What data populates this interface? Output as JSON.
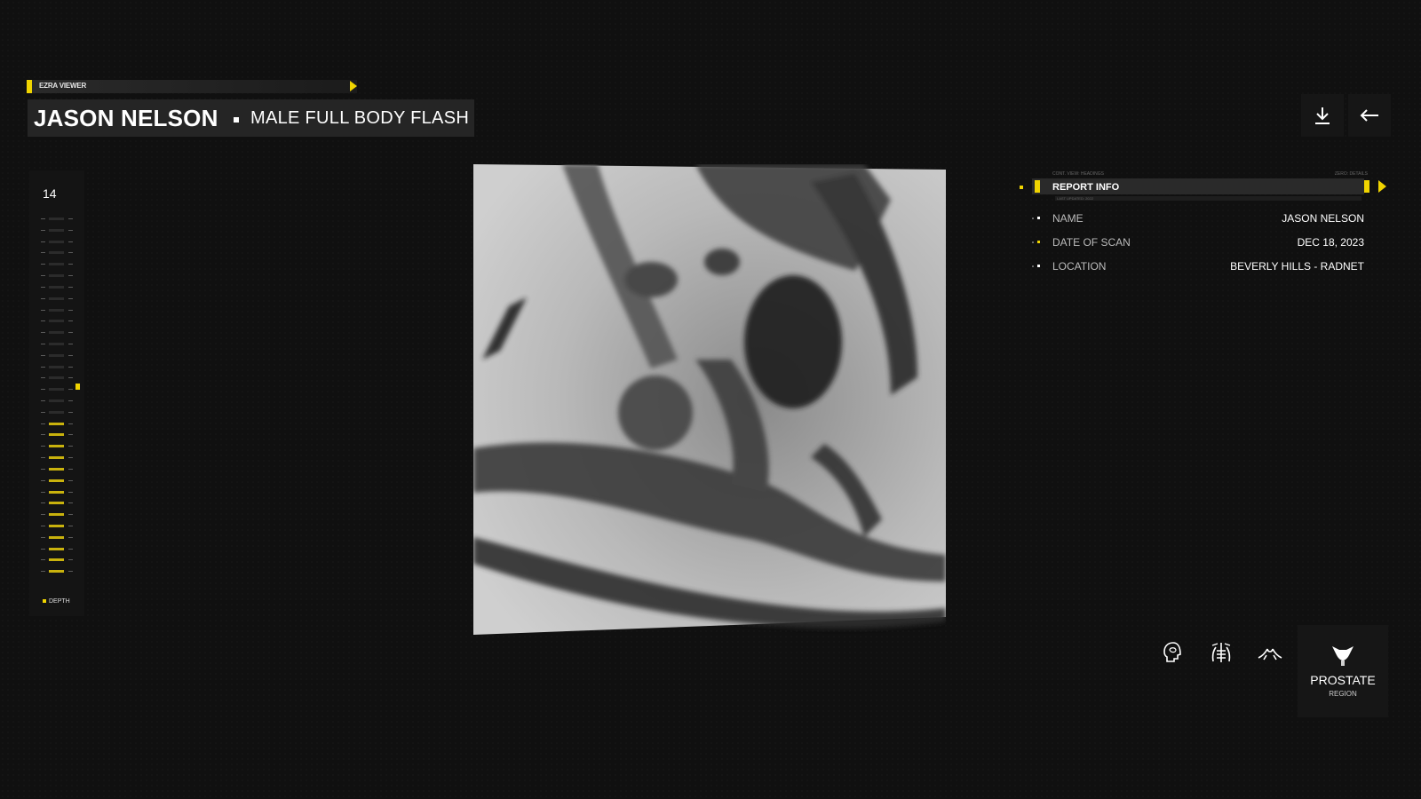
{
  "app": {
    "name": "EZRA VIEWER"
  },
  "header": {
    "patient_name": "JASON NELSON",
    "scan_type": "MALE FULL BODY FLASH"
  },
  "toolbar": {
    "download_icon": "download-icon",
    "back_icon": "arrow-left-icon"
  },
  "depth": {
    "value": "14",
    "label": "DEPTH",
    "active_fraction": 0.45,
    "accent": "#f0d400"
  },
  "report": {
    "caption_left": "CONT. VIEW: HEADINGS",
    "caption_right": "ZERO: DETAILS",
    "title": "REPORT INFO",
    "subtitle": "LAST UPDATED: 2022",
    "rows": [
      {
        "label": "NAME",
        "value": "JASON NELSON"
      },
      {
        "label": "DATE OF SCAN",
        "value": "DEC 18, 2023"
      },
      {
        "label": "LOCATION",
        "value": "BEVERLY HILLS - RADNET"
      }
    ]
  },
  "regions": {
    "options": [
      "head-icon",
      "chest-icon",
      "abdomen-icon"
    ],
    "selected": {
      "label": "PROSTATE",
      "sublabel": "REGION",
      "icon": "prostate-icon"
    }
  },
  "colors": {
    "accent": "#f0d400",
    "background": "#101010",
    "panel": "#252525"
  }
}
